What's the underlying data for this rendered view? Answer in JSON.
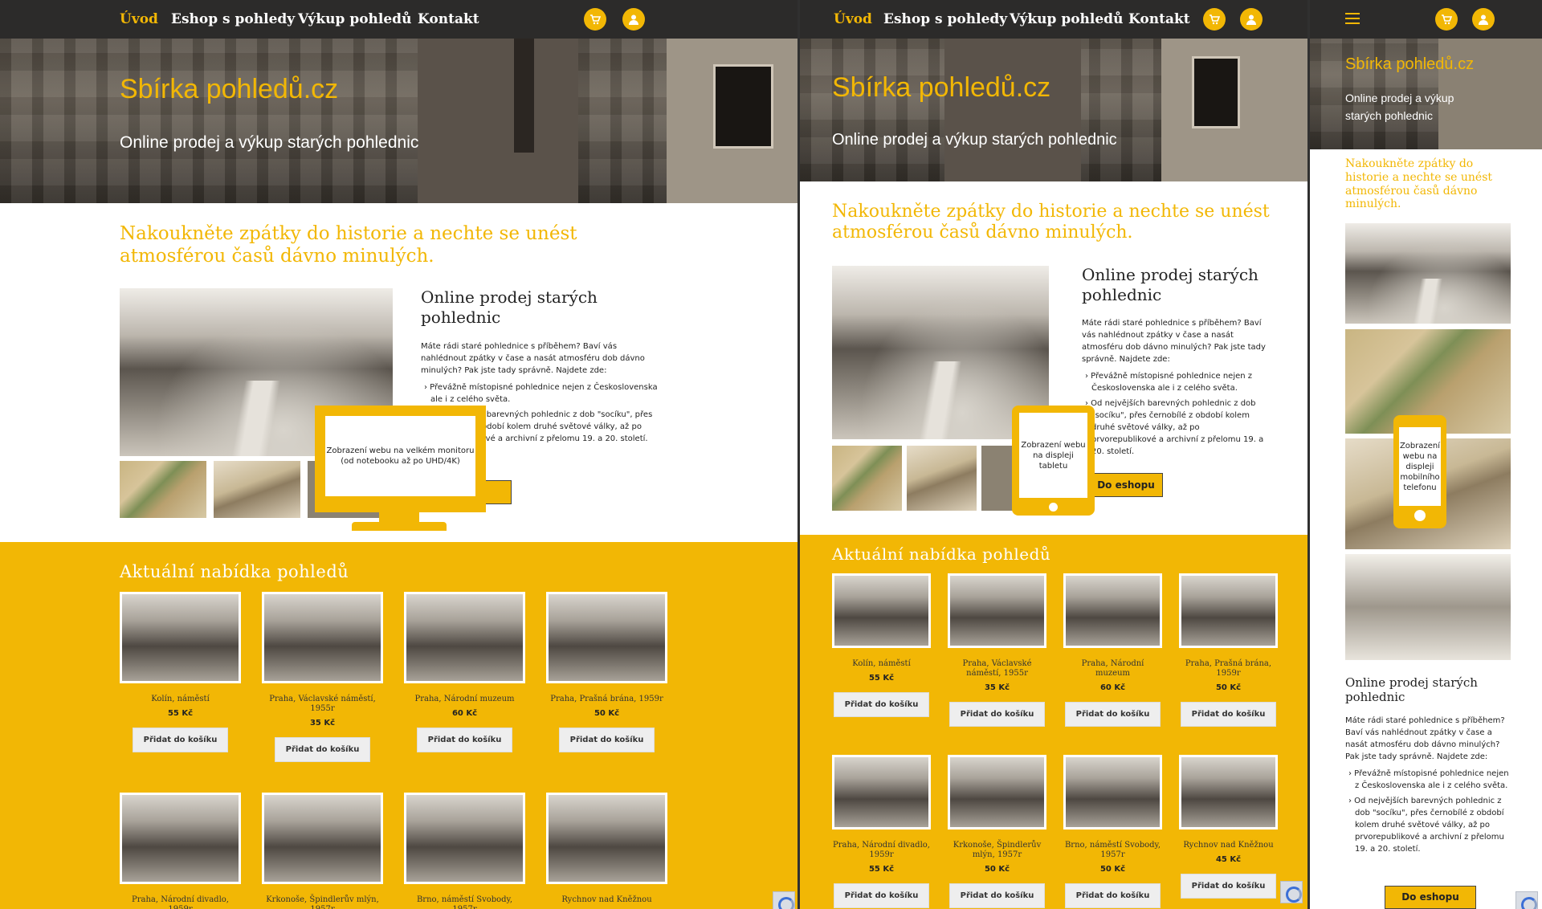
{
  "nav": {
    "items": [
      "Úvod",
      "Eshop s pohledy",
      "Výkup pohledů",
      "Kontakt"
    ],
    "cart_icon": "cart-icon",
    "user_icon": "user-icon",
    "menu_icon": "hamburger-icon"
  },
  "hero": {
    "title": "Sbírka pohledů.cz",
    "subtitle": "Online prodej a výkup starých pohlednic"
  },
  "tagline": "Nakoukněte zpátky do historie a nechte se unést atmosférou časů dávno minulých.",
  "intro": {
    "heading": "Online prodej starých pohlednic",
    "p1": "Máte rádi staré pohlednice s příběhem? Baví vás nahlédnout zpátky v čase a nasát atmosféru dob dávno minulých? Pak jste tady správně. Najdete zde:",
    "b1": "› Převážně místopisné pohlednice nejen z Československa ale i z celého světa.",
    "b2": "› Od nejvějších barevných pohlednic z dob \"socíku\", přes černobílé z období kolem druhé světové války, až po prvorepublikové a archivní z přelomu 19. a 20. století.",
    "button": "Do eshopu"
  },
  "devices": {
    "monitor": "Zobrazení webu na velkém monitoru (od notebooku až po UHD/4K)",
    "tablet": "Zobrazení webu na displeji tabletu",
    "phone": "Zobrazení webu na displeji mobilního telefonu"
  },
  "offer": {
    "title": "Aktuální nabídka pohledů",
    "add_label": "Přidat do košíku",
    "products": [
      {
        "name": "Kolín, náměstí",
        "price": "55 Kč"
      },
      {
        "name": "Praha, Václavské náměstí, 1955r",
        "price": "35 Kč"
      },
      {
        "name": "Praha, Národní muzeum",
        "price": "60 Kč"
      },
      {
        "name": "Praha, Prašná brána, 1959r",
        "price": "50 Kč"
      },
      {
        "name": "Praha, Národní divadlo, 1959r",
        "price": "55 Kč"
      },
      {
        "name": "Krkonoše, Špindlerův mlýn, 1957r",
        "price": "50 Kč"
      },
      {
        "name": "Brno, náměstí Svobody, 1957r",
        "price": "50 Kč"
      },
      {
        "name": "Rychnov nad Kněžnou",
        "price": "45 Kč"
      }
    ]
  },
  "colors": {
    "accent": "#f2b705",
    "nav_bg": "#2c2b2a"
  }
}
